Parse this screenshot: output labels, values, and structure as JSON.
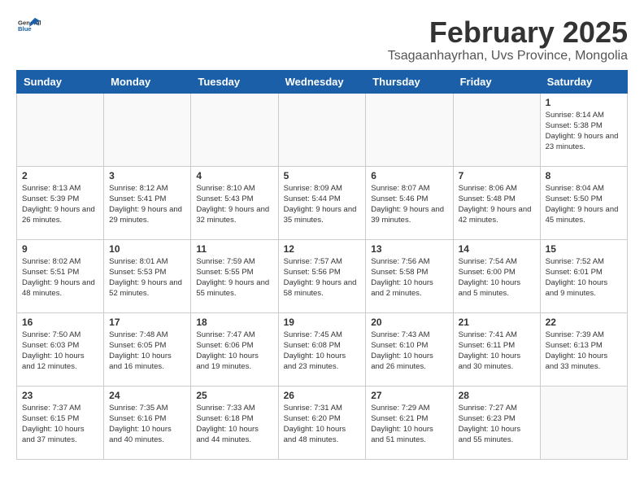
{
  "logo": {
    "general": "General",
    "blue": "Blue"
  },
  "title": "February 2025",
  "location": "Tsagaanhayrhan, Uvs Province, Mongolia",
  "days_of_week": [
    "Sunday",
    "Monday",
    "Tuesday",
    "Wednesday",
    "Thursday",
    "Friday",
    "Saturday"
  ],
  "weeks": [
    [
      {
        "day": "",
        "info": ""
      },
      {
        "day": "",
        "info": ""
      },
      {
        "day": "",
        "info": ""
      },
      {
        "day": "",
        "info": ""
      },
      {
        "day": "",
        "info": ""
      },
      {
        "day": "",
        "info": ""
      },
      {
        "day": "1",
        "info": "Sunrise: 8:14 AM\nSunset: 5:38 PM\nDaylight: 9 hours and 23 minutes."
      }
    ],
    [
      {
        "day": "2",
        "info": "Sunrise: 8:13 AM\nSunset: 5:39 PM\nDaylight: 9 hours and 26 minutes."
      },
      {
        "day": "3",
        "info": "Sunrise: 8:12 AM\nSunset: 5:41 PM\nDaylight: 9 hours and 29 minutes."
      },
      {
        "day": "4",
        "info": "Sunrise: 8:10 AM\nSunset: 5:43 PM\nDaylight: 9 hours and 32 minutes."
      },
      {
        "day": "5",
        "info": "Sunrise: 8:09 AM\nSunset: 5:44 PM\nDaylight: 9 hours and 35 minutes."
      },
      {
        "day": "6",
        "info": "Sunrise: 8:07 AM\nSunset: 5:46 PM\nDaylight: 9 hours and 39 minutes."
      },
      {
        "day": "7",
        "info": "Sunrise: 8:06 AM\nSunset: 5:48 PM\nDaylight: 9 hours and 42 minutes."
      },
      {
        "day": "8",
        "info": "Sunrise: 8:04 AM\nSunset: 5:50 PM\nDaylight: 9 hours and 45 minutes."
      }
    ],
    [
      {
        "day": "9",
        "info": "Sunrise: 8:02 AM\nSunset: 5:51 PM\nDaylight: 9 hours and 48 minutes."
      },
      {
        "day": "10",
        "info": "Sunrise: 8:01 AM\nSunset: 5:53 PM\nDaylight: 9 hours and 52 minutes."
      },
      {
        "day": "11",
        "info": "Sunrise: 7:59 AM\nSunset: 5:55 PM\nDaylight: 9 hours and 55 minutes."
      },
      {
        "day": "12",
        "info": "Sunrise: 7:57 AM\nSunset: 5:56 PM\nDaylight: 9 hours and 58 minutes."
      },
      {
        "day": "13",
        "info": "Sunrise: 7:56 AM\nSunset: 5:58 PM\nDaylight: 10 hours and 2 minutes."
      },
      {
        "day": "14",
        "info": "Sunrise: 7:54 AM\nSunset: 6:00 PM\nDaylight: 10 hours and 5 minutes."
      },
      {
        "day": "15",
        "info": "Sunrise: 7:52 AM\nSunset: 6:01 PM\nDaylight: 10 hours and 9 minutes."
      }
    ],
    [
      {
        "day": "16",
        "info": "Sunrise: 7:50 AM\nSunset: 6:03 PM\nDaylight: 10 hours and 12 minutes."
      },
      {
        "day": "17",
        "info": "Sunrise: 7:48 AM\nSunset: 6:05 PM\nDaylight: 10 hours and 16 minutes."
      },
      {
        "day": "18",
        "info": "Sunrise: 7:47 AM\nSunset: 6:06 PM\nDaylight: 10 hours and 19 minutes."
      },
      {
        "day": "19",
        "info": "Sunrise: 7:45 AM\nSunset: 6:08 PM\nDaylight: 10 hours and 23 minutes."
      },
      {
        "day": "20",
        "info": "Sunrise: 7:43 AM\nSunset: 6:10 PM\nDaylight: 10 hours and 26 minutes."
      },
      {
        "day": "21",
        "info": "Sunrise: 7:41 AM\nSunset: 6:11 PM\nDaylight: 10 hours and 30 minutes."
      },
      {
        "day": "22",
        "info": "Sunrise: 7:39 AM\nSunset: 6:13 PM\nDaylight: 10 hours and 33 minutes."
      }
    ],
    [
      {
        "day": "23",
        "info": "Sunrise: 7:37 AM\nSunset: 6:15 PM\nDaylight: 10 hours and 37 minutes."
      },
      {
        "day": "24",
        "info": "Sunrise: 7:35 AM\nSunset: 6:16 PM\nDaylight: 10 hours and 40 minutes."
      },
      {
        "day": "25",
        "info": "Sunrise: 7:33 AM\nSunset: 6:18 PM\nDaylight: 10 hours and 44 minutes."
      },
      {
        "day": "26",
        "info": "Sunrise: 7:31 AM\nSunset: 6:20 PM\nDaylight: 10 hours and 48 minutes."
      },
      {
        "day": "27",
        "info": "Sunrise: 7:29 AM\nSunset: 6:21 PM\nDaylight: 10 hours and 51 minutes."
      },
      {
        "day": "28",
        "info": "Sunrise: 7:27 AM\nSunset: 6:23 PM\nDaylight: 10 hours and 55 minutes."
      },
      {
        "day": "",
        "info": ""
      }
    ]
  ],
  "colors": {
    "header_bg": "#1a5fa8",
    "header_text": "#ffffff",
    "border": "#cccccc",
    "empty_bg": "#f9f9f9"
  }
}
